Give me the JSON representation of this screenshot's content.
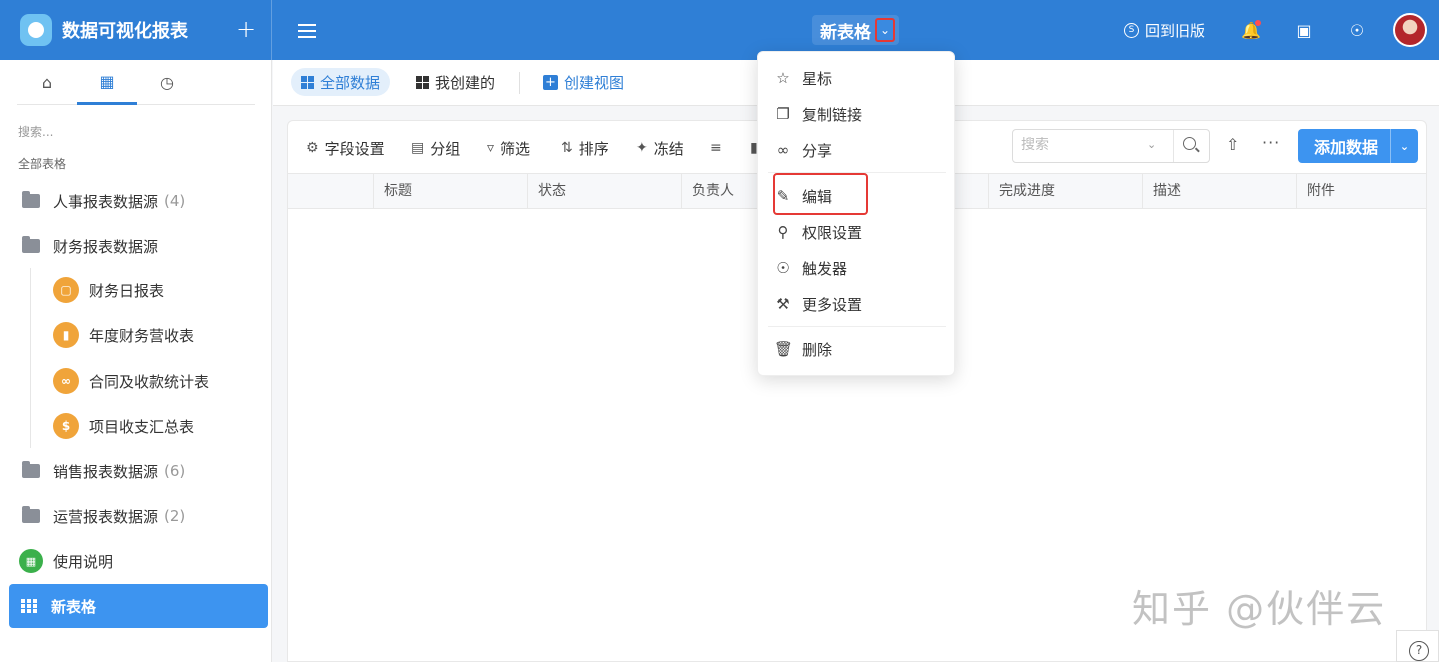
{
  "header": {
    "app_title": "数据可视化报表",
    "doc_title": "新表格",
    "old_version": "回到旧版"
  },
  "sidebar": {
    "search_placeholder": "搜索...",
    "section_label": "全部表格",
    "items": [
      {
        "label": "人事报表数据源",
        "count": "(4)"
      },
      {
        "label": "财务报表数据源"
      },
      {
        "label": "财务日报表"
      },
      {
        "label": "年度财务营收表"
      },
      {
        "label": "合同及收款统计表"
      },
      {
        "label": "项目收支汇总表"
      },
      {
        "label": "销售报表数据源",
        "count": "(6)"
      },
      {
        "label": "运营报表数据源",
        "count": "(2)"
      },
      {
        "label": "使用说明"
      },
      {
        "label": "新表格"
      }
    ]
  },
  "views": {
    "all": "全部数据",
    "mine": "我创建的",
    "create": "创建视图"
  },
  "toolbar": {
    "fields": "字段设置",
    "group": "分组",
    "filter": "筛选",
    "sort": "排序",
    "freeze": "冻结",
    "search_placeholder": "搜索",
    "add_data": "添加数据"
  },
  "table": {
    "columns": [
      "标题",
      "状态",
      "负责人",
      "完成进度",
      "描述",
      "附件"
    ]
  },
  "menu": {
    "items": [
      "星标",
      "复制链接",
      "分享",
      "编辑",
      "权限设置",
      "触发器",
      "更多设置",
      "删除"
    ]
  },
  "watermark": "知乎 @伙伴云",
  "colors": {
    "primary": "#2f7fd6",
    "highlight": "#e53935",
    "orange": "#f0a43a",
    "green": "#3bb04b"
  }
}
